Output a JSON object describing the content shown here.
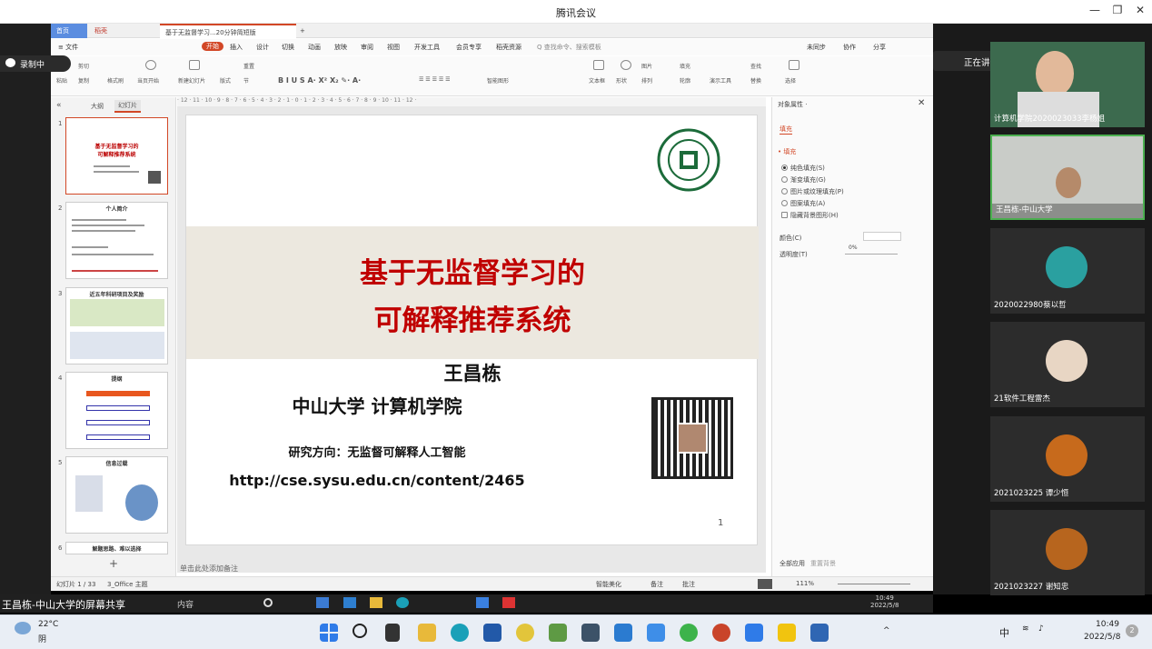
{
  "meeting": {
    "title": "腾讯会议",
    "recording": "录制中",
    "speaking": "正在讲话: 王昌栋-中山大学",
    "share_label": "王昌栋-中山大学的屏幕共享"
  },
  "wps": {
    "tabs": {
      "home": "首页",
      "daoke": "稻壳",
      "doc": "基于无监督学习...20分钟简短版"
    },
    "menus": [
      "≡ 文件",
      "开始",
      "插入",
      "设计",
      "切换",
      "动画",
      "放映",
      "审阅",
      "视图",
      "开发工具",
      "会员专享",
      "稻壳资源",
      "Q 查找命令、搜索模板"
    ],
    "right_actions": [
      "未同步",
      "协作",
      "分享"
    ],
    "tools": {
      "cut": "剪切",
      "paste": "粘贴",
      "copy": "复制",
      "format": "格式刷",
      "play": "当页开始",
      "newslide": "新建幻灯片",
      "layout": "版式",
      "section": "节",
      "reset": "重置",
      "textbox": "文本框",
      "shape": "形状",
      "arrange": "排列",
      "outline": "轮廓",
      "picture": "图片",
      "fill": "填充",
      "find": "查找",
      "replace": "替换",
      "select": "选择",
      "tools": "演示工具",
      "smart": "智能图形",
      "textfx": "文字效果"
    },
    "thumb_tabs": {
      "outline": "大纲",
      "slides": "幻灯片"
    },
    "thumbs": [
      {
        "num": "1",
        "lines": [
          "基于无监督学习的",
          "可解释推荐系统"
        ]
      },
      {
        "num": "2",
        "lines": [
          "个人简介"
        ]
      },
      {
        "num": "3",
        "lines": [
          "近五年科研项目及奖励"
        ]
      },
      {
        "num": "4",
        "lines": [
          "提纲"
        ]
      },
      {
        "num": "5",
        "lines": [
          "信息过载"
        ]
      },
      {
        "num": "6",
        "lines": [
          "解题思路、难以选择"
        ]
      }
    ],
    "slide": {
      "title_l1": "基于无监督学习的",
      "title_l2": "可解释推荐系统",
      "author": "王昌栋",
      "affil": "中山大学 计算机学院",
      "research": "研究方向：无监督可解释人工智能",
      "url": "http://cse.sysu.edu.cn/content/2465",
      "page": "1",
      "logo": "中山大学 SUN YAT-SEN UNIVERSITY"
    },
    "notes": "单击此处添加备注",
    "pane": {
      "title": "对象属性 ·",
      "tab": "填充",
      "section": "• 填充",
      "options": [
        "纯色填充(S)",
        "渐变填充(G)",
        "图片或纹理填充(P)",
        "图案填充(A)",
        "隐藏背景图形(H)"
      ],
      "color": "颜色(C)",
      "transparency": "透明度(T)",
      "pct": "0%",
      "apply_all": "全部应用",
      "reset_bg": "重置背景"
    },
    "status": {
      "slide": "幻灯片 1 / 33",
      "theme": "3_Office 主题",
      "beautify": "智能美化",
      "notes": "备注",
      "comment": "批注",
      "zoom": "111%"
    }
  },
  "participants": [
    {
      "name": "计算机学院2020023033李杨姐"
    },
    {
      "name": "王昌栋-中山大学"
    },
    {
      "name": "2020022980蔡以哲"
    },
    {
      "name": "21软件工程雷杰"
    },
    {
      "name": "2021023225 谭少恒"
    },
    {
      "name": "2021023227 谢知忠"
    }
  ],
  "inner_taskbar": {
    "time": "10:49",
    "date": "2022/5/8",
    "search": "内容"
  },
  "taskbar": {
    "temp": "22°C",
    "weather": "阴",
    "time": "10:49",
    "date": "2022/5/8",
    "ime": "中",
    "notif": "2"
  }
}
